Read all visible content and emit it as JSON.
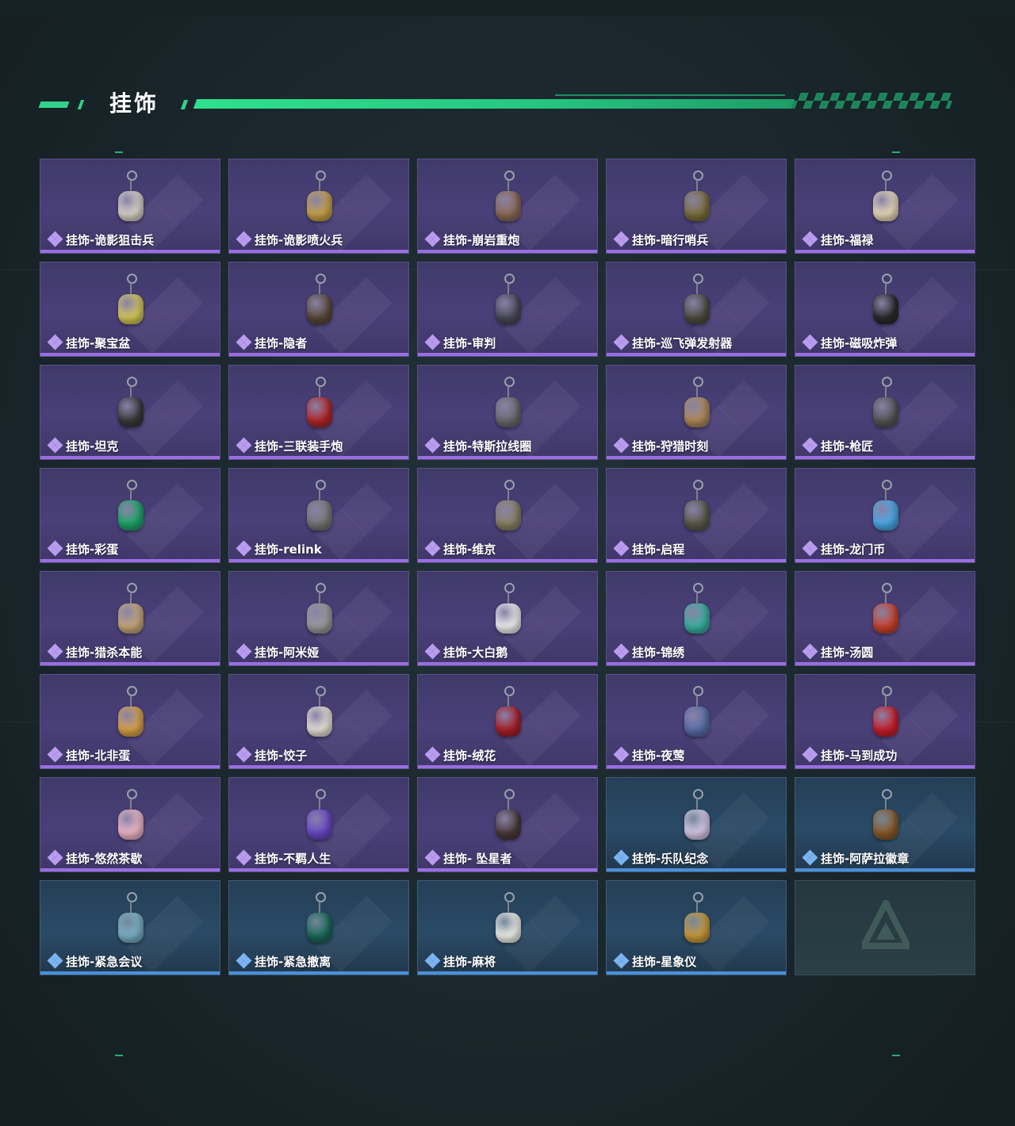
{
  "header": {
    "title": "挂饰"
  },
  "colors": {
    "accent": "#31d38a",
    "rare_purple": "#9a6ee0",
    "rare_blue": "#4b8fd9"
  },
  "items": [
    {
      "label": "挂饰-诡影狙击兵",
      "rarity": "purple",
      "color": "#d8d3c8"
    },
    {
      "label": "挂饰-诡影喷火兵",
      "rarity": "purple",
      "color": "#c9a24a"
    },
    {
      "label": "挂饰-崩岩重炮",
      "rarity": "purple",
      "color": "#8b6a55"
    },
    {
      "label": "挂饰-暗行哨兵",
      "rarity": "purple",
      "color": "#7a6f3c"
    },
    {
      "label": "挂饰-福禄",
      "rarity": "purple",
      "color": "#e8d9b8"
    },
    {
      "label": "挂饰-聚宝盆",
      "rarity": "purple",
      "color": "#d6c85a"
    },
    {
      "label": "挂饰-隐者",
      "rarity": "purple",
      "color": "#5a4a3a"
    },
    {
      "label": "挂饰-审判",
      "rarity": "purple",
      "color": "#4a4a5a"
    },
    {
      "label": "挂饰-巡飞弹发射器",
      "rarity": "purple",
      "color": "#4d4d42"
    },
    {
      "label": "挂饰-磁吸炸弹",
      "rarity": "purple",
      "color": "#2a2a2a"
    },
    {
      "label": "挂饰-坦克",
      "rarity": "purple",
      "color": "#3a3a3a"
    },
    {
      "label": "挂饰-三联装手炮",
      "rarity": "purple",
      "color": "#b3282a"
    },
    {
      "label": "挂饰-特斯拉线圈",
      "rarity": "purple",
      "color": "#6a6a6e"
    },
    {
      "label": "挂饰-狩猎时刻",
      "rarity": "purple",
      "color": "#b08a5a"
    },
    {
      "label": "挂饰-枪匠",
      "rarity": "purple",
      "color": "#555555"
    },
    {
      "label": "挂饰-彩蛋",
      "rarity": "purple",
      "color": "#1fa66a"
    },
    {
      "label": "挂饰-relink",
      "rarity": "purple",
      "color": "#777777"
    },
    {
      "label": "挂饰-维京",
      "rarity": "purple",
      "color": "#8a8266"
    },
    {
      "label": "挂饰-启程",
      "rarity": "purple",
      "color": "#5a5a4a"
    },
    {
      "label": "挂饰-龙门币",
      "rarity": "purple",
      "color": "#4aa9e8"
    },
    {
      "label": "挂饰-猎杀本能",
      "rarity": "purple",
      "color": "#c8a878"
    },
    {
      "label": "挂饰-阿米娅",
      "rarity": "purple",
      "color": "#9a9a9a"
    },
    {
      "label": "挂饰-大白鹅",
      "rarity": "purple",
      "color": "#f0f0f0"
    },
    {
      "label": "挂饰-锦绣",
      "rarity": "purple",
      "color": "#3ab0a0"
    },
    {
      "label": "挂饰-汤圆",
      "rarity": "purple",
      "color": "#c8442e"
    },
    {
      "label": "挂饰-北非蛋",
      "rarity": "purple",
      "color": "#d9a24a"
    },
    {
      "label": "挂饰-饺子",
      "rarity": "purple",
      "color": "#e8e2d8"
    },
    {
      "label": "挂饰-绒花",
      "rarity": "purple",
      "color": "#a8202a"
    },
    {
      "label": "挂饰-夜莺",
      "rarity": "purple",
      "color": "#5a6fa8"
    },
    {
      "label": "挂饰-马到成功",
      "rarity": "purple",
      "color": "#c8202a"
    },
    {
      "label": "挂饰-悠然茶歇",
      "rarity": "purple",
      "color": "#f0b8c8"
    },
    {
      "label": "挂饰-不羁人生",
      "rarity": "purple",
      "color": "#6a48c8"
    },
    {
      "label": "挂饰- 坠星者",
      "rarity": "purple",
      "color": "#4a3a3a"
    },
    {
      "label": "挂饰-乐队纪念",
      "rarity": "blue",
      "color": "#d8c8e8"
    },
    {
      "label": "挂饰-阿萨拉徽章",
      "rarity": "blue",
      "color": "#8a5a2a"
    },
    {
      "label": "挂饰-紧急会议",
      "rarity": "blue",
      "color": "#7ab0c8"
    },
    {
      "label": "挂饰-紧急撤离",
      "rarity": "blue",
      "color": "#1a6a5a"
    },
    {
      "label": "挂饰-麻将",
      "rarity": "blue",
      "color": "#f0f0ea"
    },
    {
      "label": "挂饰-星象仪",
      "rarity": "blue",
      "color": "#c89a3a"
    }
  ]
}
